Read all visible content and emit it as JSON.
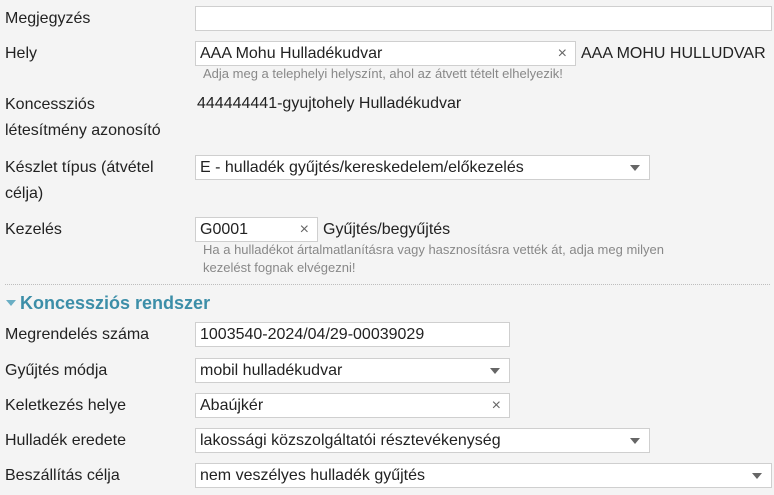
{
  "form": {
    "megjegyzes": {
      "label": "Megjegyzés",
      "value": ""
    },
    "hely": {
      "label": "Hely",
      "value": "AAA Mohu Hulladékudvar",
      "display": "AAA MOHU HULLUDVAR",
      "help": "Adja meg a telephelyi helyszínt, ahol az átvett tételt elhelyezik!"
    },
    "koncesszios": {
      "label_line1": "Koncessziós",
      "label_line2": "létesítmény azonosító",
      "value": "444444441-gyujtohely Hulladékudvar"
    },
    "keszlet": {
      "label_line1": "Készlet típus (átvétel",
      "label_line2": "célja)",
      "value": "E - hulladék gyűjtés/kereskedelem/előkezelés"
    },
    "kezeles": {
      "label": "Kezelés",
      "value": "G0001",
      "display": "Gyűjtés/begyűjtés",
      "help_line1": "Ha a hulladékot ártalmatlanításra vagy hasznosításra vették át, adja meg milyen",
      "help_line2": "kezelést fognak elvégezni!"
    }
  },
  "section": {
    "title": "Koncessziós rendszer",
    "megrendeles": {
      "label": "Megrendelés száma",
      "value": "1003540-2024/04/29-00039029"
    },
    "gyujtes": {
      "label": "Gyűjtés módja",
      "value": "mobil hulladékudvar"
    },
    "keletkezes": {
      "label": "Keletkezés helye",
      "value": "Abaújkér"
    },
    "eredet": {
      "label": "Hulladék eredete",
      "value": "lakossági közszolgáltatói résztevékenység"
    },
    "celja": {
      "label": "Beszállítás célja",
      "value": "nem veszélyes hulladék gyűjtés"
    }
  },
  "icons": {
    "clear": "×",
    "dropdown": "chevron-down-icon"
  },
  "colors": {
    "section": "#3c8ea8",
    "help": "#888888",
    "border": "#cfcfcf"
  }
}
